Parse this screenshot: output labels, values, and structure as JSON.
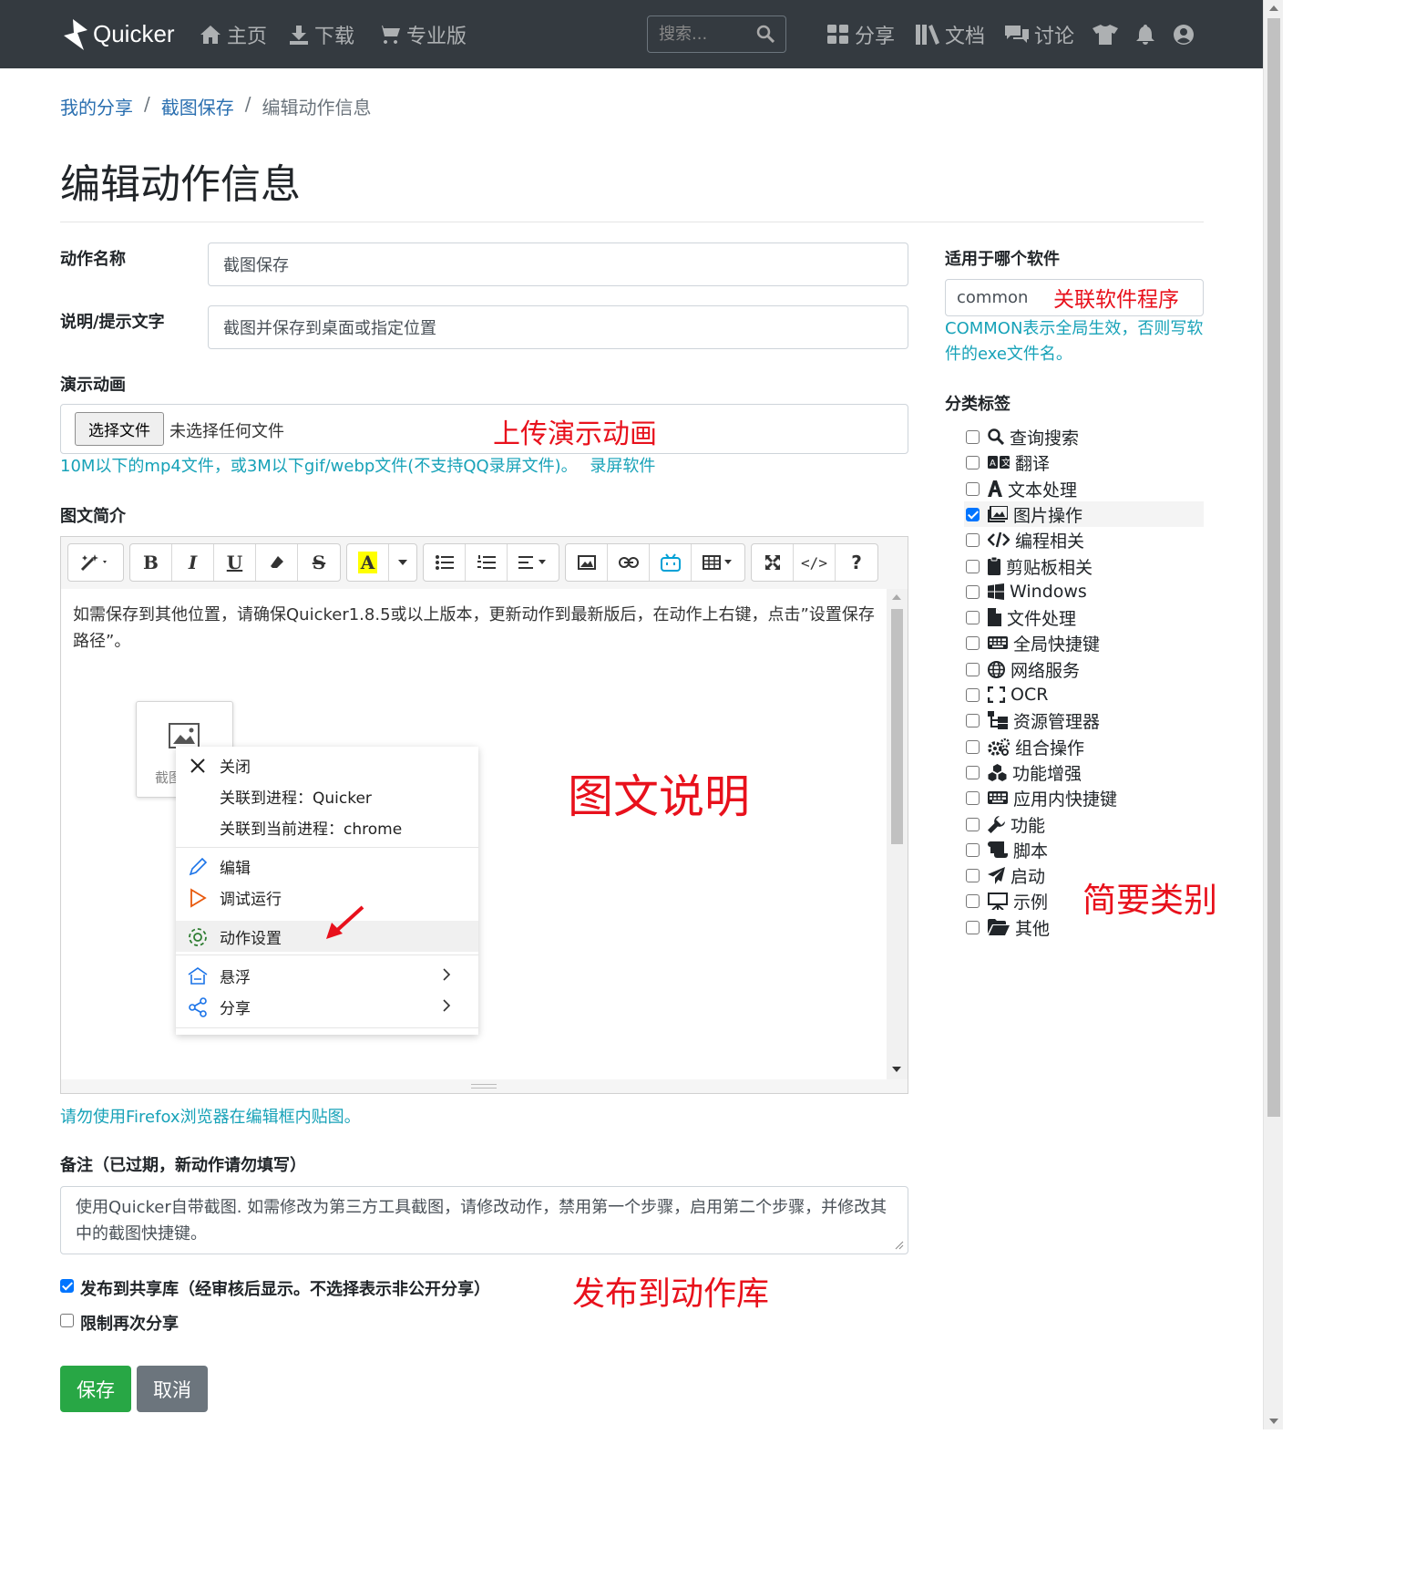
{
  "navbar": {
    "brand": "Quicker",
    "home": "主页",
    "download": "下载",
    "pro": "专业版",
    "search_placeholder": "搜索...",
    "share": "分享",
    "docs": "文档",
    "discuss": "讨论"
  },
  "breadcrumb": {
    "item1": "我的分享",
    "item2": "截图保存",
    "current": "编辑动作信息",
    "separator": "/"
  },
  "page_title": "编辑动作信息",
  "form": {
    "name_label": "动作名称",
    "name_value": "截图保存",
    "desc_label": "说明/提示文字",
    "desc_value": "截图并保存到桌面或指定位置",
    "demo_label": "演示动画",
    "file_button": "选择文件",
    "file_status": "未选择任何文件",
    "demo_help": "10M以下的mp4文件，或3M以下gif/webp文件(不支持QQ录屏文件)。",
    "demo_link": "录屏软件",
    "intro_label": "图文简介",
    "editor_text": "如需保存到其他位置，请确保Quicker1.8.5或以上版本，更新动作到最新版后，在动作上右键，点击”设置保存路径”。",
    "editor_help": "请勿使用Firefox浏览器在编辑框内贴图。",
    "notes_label": "备注（已过期，新动作请勿填写）",
    "notes_value": "使用Quicker自带截图. 如需修改为第三方工具截图，请修改动作，禁用第一个步骤，启用第二个步骤，并修改其中的截图快捷键。",
    "publish_label": "发布到共享库（经审核后显示。不选择表示非公开分享）",
    "publish_checked": true,
    "limit_label": "限制再次分享",
    "limit_checked": false,
    "save_button": "保存",
    "cancel_button": "取消"
  },
  "embedded_menu": {
    "tile_label": "截图",
    "items": [
      "关闭",
      "关联到进程：Quicker",
      "关联到当前进程：chrome",
      "编辑",
      "调试运行",
      "动作设置",
      "悬浮",
      "分享"
    ]
  },
  "sidebar": {
    "software_label": "适用于哪个软件",
    "software_value": "common",
    "software_help": "COMMON表示全局生效，否则写软件的exe文件名。",
    "tags_label": "分类标签",
    "tags": [
      {
        "label": "查询搜索",
        "icon": "search-icon",
        "checked": false
      },
      {
        "label": "翻译",
        "icon": "translate-icon",
        "checked": false
      },
      {
        "label": "文本处理",
        "icon": "font-icon",
        "checked": false
      },
      {
        "label": "图片操作",
        "icon": "images-icon",
        "checked": true
      },
      {
        "label": "编程相关",
        "icon": "code-icon",
        "checked": false
      },
      {
        "label": "剪贴板相关",
        "icon": "clipboard-icon",
        "checked": false
      },
      {
        "label": "Windows",
        "icon": "windows-icon",
        "checked": false
      },
      {
        "label": "文件处理",
        "icon": "file-icon",
        "checked": false
      },
      {
        "label": "全局快捷键",
        "icon": "keyboard-icon",
        "checked": false
      },
      {
        "label": "网络服务",
        "icon": "globe-icon",
        "checked": false
      },
      {
        "label": "OCR",
        "icon": "scan-icon",
        "checked": false
      },
      {
        "label": "资源管理器",
        "icon": "sitemap-icon",
        "checked": false
      },
      {
        "label": "组合操作",
        "icon": "cogs-icon",
        "checked": false
      },
      {
        "label": "功能增强",
        "icon": "cubes-icon",
        "checked": false
      },
      {
        "label": "应用内快捷键",
        "icon": "keyboard-icon",
        "checked": false
      },
      {
        "label": "功能",
        "icon": "wrench-icon",
        "checked": false
      },
      {
        "label": "脚本",
        "icon": "scroll-icon",
        "checked": false
      },
      {
        "label": "启动",
        "icon": "paper-plane-icon",
        "checked": false
      },
      {
        "label": "示例",
        "icon": "chalkboard-icon",
        "checked": false
      },
      {
        "label": "其他",
        "icon": "folder-open-icon",
        "checked": false
      }
    ]
  },
  "annotations": {
    "software": "关联软件程序",
    "upload": "上传演示动画",
    "rich_text": "图文说明",
    "category": "简要类别",
    "publish": "发布到动作库"
  },
  "colors": {
    "navbar_bg": "#343a40",
    "link": "#2a6fb0",
    "help": "#17a2b8",
    "annotation": "#e8111c",
    "save": "#28a745",
    "cancel": "#6c757d",
    "checkbox": "#0075ff"
  }
}
